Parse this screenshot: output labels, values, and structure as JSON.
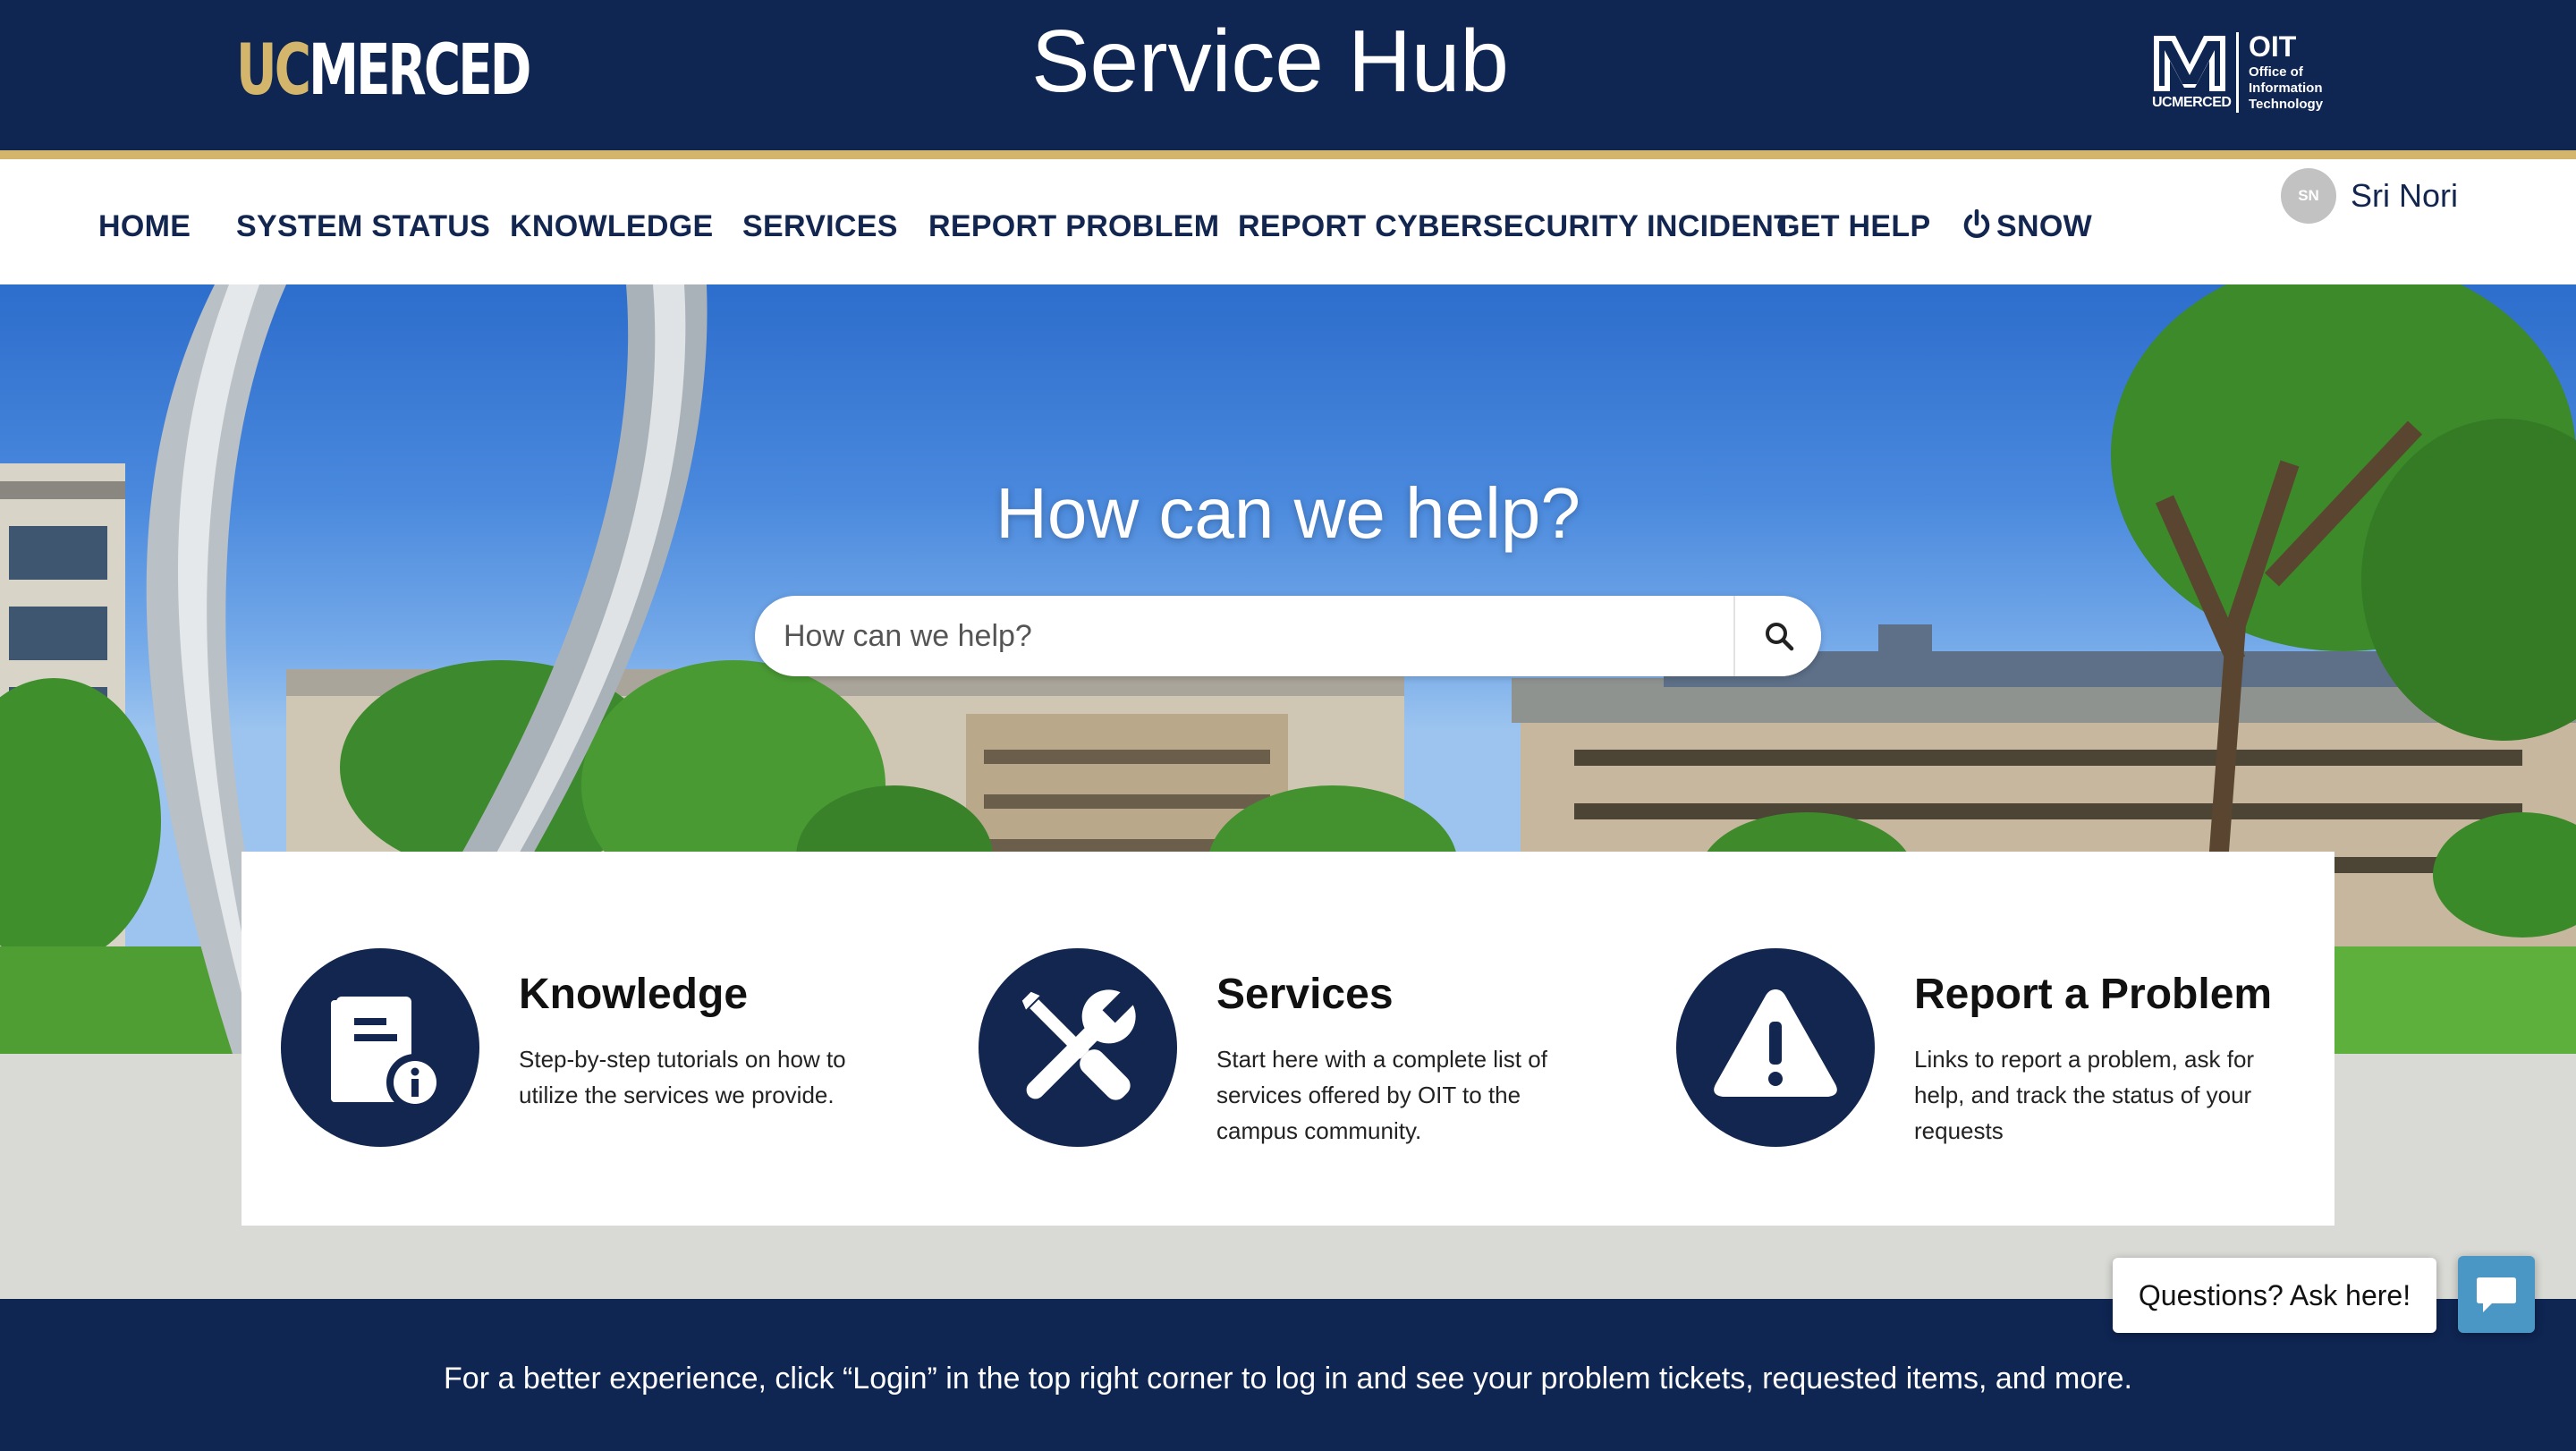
{
  "header": {
    "logo_uc": "UC",
    "logo_merced": "MERCED",
    "title": "Service Hub",
    "oit_abbrev": "OIT",
    "oit_full": "Office of Information Technology",
    "oit_wordmark": "UCMERCED"
  },
  "nav": {
    "items": [
      {
        "label": "HOME"
      },
      {
        "label": "SYSTEM STATUS"
      },
      {
        "label": "KNOWLEDGE"
      },
      {
        "label": "SERVICES"
      },
      {
        "label": "REPORT PROBLEM"
      },
      {
        "label": "REPORT CYBERSECURITY INCIDENT"
      },
      {
        "label": "GET HELP"
      },
      {
        "label": "SNOW",
        "icon": "power-icon"
      }
    ],
    "user": {
      "initials": "SN",
      "name": "Sri Nori"
    }
  },
  "hero": {
    "heading": "How can we help?",
    "search_placeholder": "How can we help?",
    "search_icon": "search-icon"
  },
  "features": [
    {
      "icon": "knowledge-book-info-icon",
      "title": "Knowledge",
      "description": "Step-by-step tutorials on how to utilize the services we provide."
    },
    {
      "icon": "wrench-screwdriver-icon",
      "title": "Services",
      "description": "Start here with a complete list of services offered by OIT to the campus community."
    },
    {
      "icon": "warning-triangle-icon",
      "title": "Report a Problem",
      "description": "Links to report a problem, ask for help, and track the status of your requests"
    }
  ],
  "footer": {
    "text": "For a better experience, click “Login” in the top right corner to log in and see your problem tickets, requested items, and more."
  },
  "chat": {
    "prompt": "Questions? Ask here!",
    "icon": "chat-icon"
  },
  "colors": {
    "navy": "#0f2552",
    "gold": "#d3b66b",
    "nav_text": "#12264f",
    "gray_band": "#d9dad5",
    "chat_blue": "#4a96c4"
  }
}
